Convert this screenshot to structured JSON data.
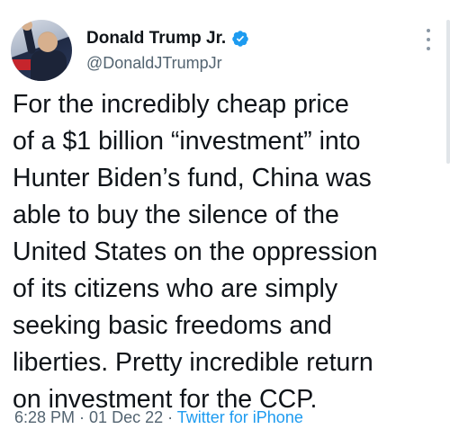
{
  "author": {
    "display_name": "Donald Trump Jr.",
    "handle": "@DonaldJTrumpJr",
    "verified": true,
    "verified_color": "#1d9bf0"
  },
  "tweet": {
    "lines": [
      "For the incredibly cheap price",
      "of a $1 billion “investment” into",
      "Hunter Biden’s fund, China was",
      "able to buy the silence of the",
      "United States on the oppression",
      "of its citizens who are simply",
      "seeking basic freedoms and",
      "liberties. Pretty incredible return",
      "on investment for the CCP."
    ]
  },
  "meta": {
    "time": "6:28 PM",
    "separator_1": " · ",
    "date": "01 Dec 22",
    "separator_2": " · ",
    "source": "Twitter for iPhone",
    "source_color": "#1d9bf0"
  },
  "icons": {
    "verified": "verified-badge-icon",
    "more": "more-options-icon"
  }
}
